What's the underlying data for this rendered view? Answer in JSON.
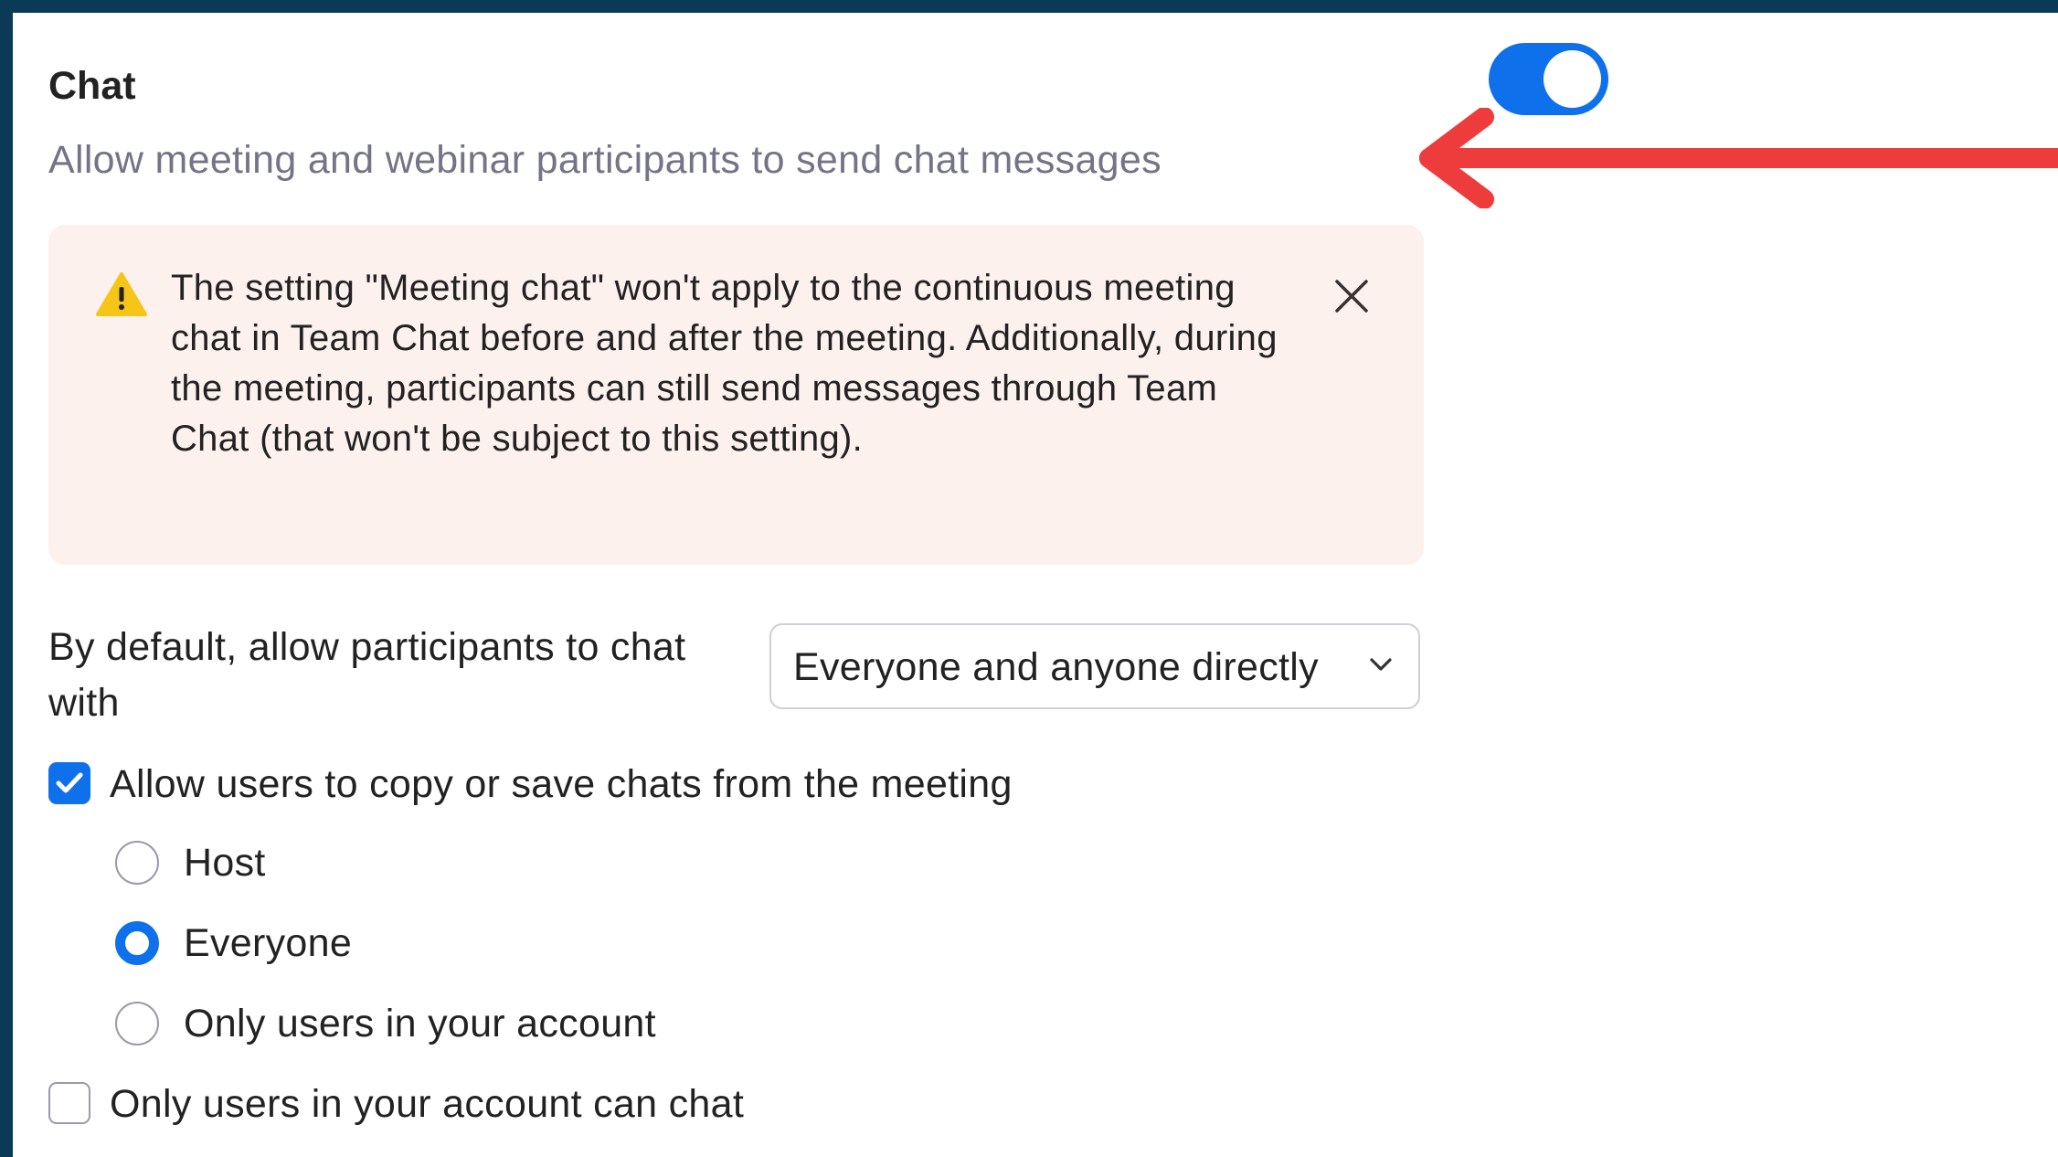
{
  "setting": {
    "title": "Chat",
    "description": "Allow meeting and webinar participants to send chat messages",
    "enabled": true
  },
  "alert": {
    "icon": "warning-icon",
    "message": "The setting \"Meeting chat\" won't apply to the continuous meeting chat in Team Chat before and after the meeting. Additionally, during the meeting, participants can still send messages through Team Chat (that won't be subject to this setting)."
  },
  "default_chat": {
    "label": "By default, allow participants to chat with",
    "selected": "Everyone and anyone directly"
  },
  "copy_save": {
    "label": "Allow users to copy or save chats from the meeting",
    "checked": true,
    "options": [
      {
        "label": "Host",
        "selected": false
      },
      {
        "label": "Everyone",
        "selected": true
      },
      {
        "label": "Only users in your account",
        "selected": false
      }
    ]
  },
  "restrict": {
    "label": "Only users in your account can chat",
    "checked": false
  },
  "colors": {
    "accent": "#0e71eb",
    "frame": "#0b3a57",
    "alert_bg": "#fdf1ee",
    "annotation_arrow": "#ee3b3b"
  }
}
